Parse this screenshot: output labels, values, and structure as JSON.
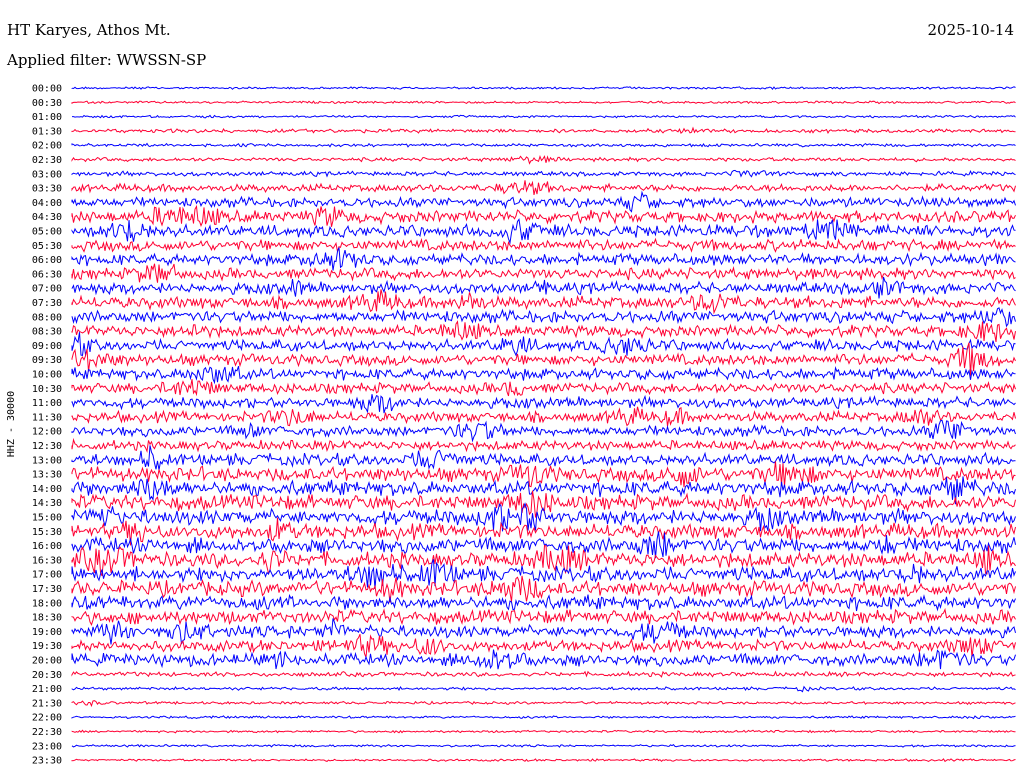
{
  "header": {
    "title": "HT Karyes, Athos Mt.",
    "date": "2025-10-14",
    "filter": "Applied filter: WWSSN-SP"
  },
  "chart_data": {
    "type": "line",
    "ylabel": "HHZ - 30000",
    "trace_colors": [
      "#0000ff",
      "#ff0033"
    ],
    "row_labels": [
      "00:00",
      "00:30",
      "01:00",
      "01:30",
      "02:00",
      "02:30",
      "03:00",
      "03:30",
      "04:00",
      "04:30",
      "05:00",
      "05:30",
      "06:00",
      "06:30",
      "07:00",
      "07:30",
      "08:00",
      "08:30",
      "09:00",
      "09:30",
      "10:00",
      "10:30",
      "11:00",
      "11:30",
      "12:00",
      "12:30",
      "13:00",
      "13:30",
      "14:00",
      "14:30",
      "15:00",
      "15:30",
      "16:00",
      "16:30",
      "17:00",
      "17:30",
      "18:00",
      "18:30",
      "19:00",
      "19:30",
      "20:00",
      "20:30",
      "21:00",
      "21:30",
      "22:00",
      "22:30",
      "23:00",
      "23:30"
    ],
    "row_activity": [
      0.3,
      0.3,
      0.3,
      0.5,
      0.4,
      0.5,
      0.6,
      1.0,
      1.3,
      1.6,
      1.6,
      1.5,
      1.5,
      1.5,
      1.5,
      1.6,
      1.6,
      1.5,
      1.5,
      1.5,
      1.5,
      1.4,
      1.4,
      1.4,
      1.4,
      1.3,
      1.6,
      1.9,
      2.0,
      2.0,
      2.0,
      2.0,
      2.0,
      2.0,
      2.0,
      2.0,
      1.9,
      1.8,
      1.6,
      1.5,
      1.6,
      0.6,
      0.4,
      0.35,
      0.3,
      0.3,
      0.3,
      0.3
    ]
  }
}
